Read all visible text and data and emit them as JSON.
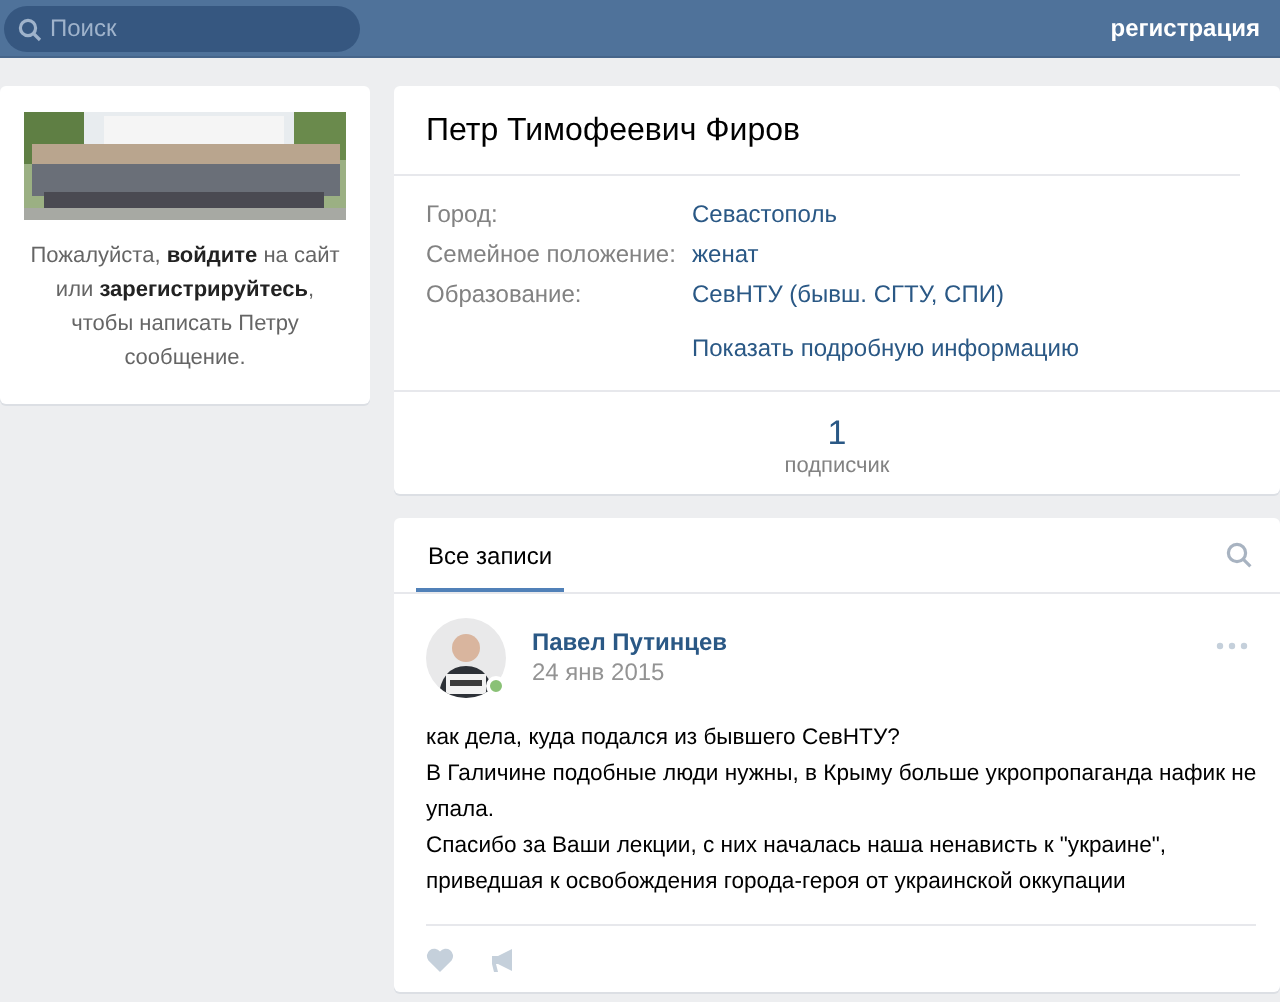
{
  "header": {
    "search": {
      "placeholder": "Поиск"
    },
    "register_link": "регистрация"
  },
  "sidebar": {
    "message": "Пожалуйста, **войдите** на сайт или **зарегистрируйтесь**, чтобы написать Петру сообщение."
  },
  "profile": {
    "name": "Петр Тимофеевич Фиров",
    "fields": [
      {
        "label": "Город:",
        "value": "Севастополь"
      },
      {
        "label": "Семейное положение:",
        "value": "женат"
      },
      {
        "label": "Образование:",
        "value": "СевНТУ (бывш. СГТУ, СПИ)"
      }
    ],
    "more_link": "Показать подробную информацию",
    "counter": {
      "value": "1",
      "label": "подписчик"
    }
  },
  "wall": {
    "tabs": [
      {
        "label": "Все записи",
        "selected": true
      }
    ],
    "posts": [
      {
        "author": "Павел Путинцев",
        "date": "24 янв 2015",
        "online": true,
        "paragraphs": [
          "как дела, куда подался из бывшего СевНТУ?",
          "В Галичине подобные люди нужны, в Крыму больше укропропаганда нафик не упала.",
          "Спасибо за Ваши лекции, с них началась наша ненависть к \"украине\", приведшая к освобождения города-героя от украинской оккупации"
        ]
      }
    ]
  }
}
